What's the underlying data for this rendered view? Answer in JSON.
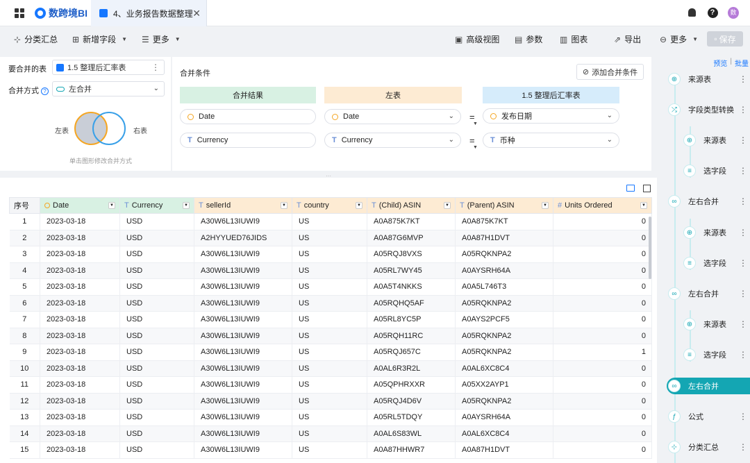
{
  "app": {
    "logo_text": "数跨境BI",
    "tab_title": "4、业务报告数据整理",
    "avatar_text": "数"
  },
  "toolbar": {
    "group_summary": "分类汇总",
    "add_field": "新增字段",
    "more_left": "更多",
    "advanced_view": "高级视图",
    "params": "参数",
    "chart": "图表",
    "export": "导出",
    "more_right": "更多",
    "save": "保存"
  },
  "config": {
    "merge_table_label": "要合并的表",
    "merge_table_value": "1.5 整理后汇率表",
    "merge_method_label": "合并方式",
    "merge_method_value": "左合并",
    "venn_left": "左表",
    "venn_right": "右表",
    "venn_hint": "单击图形修改合并方式"
  },
  "conditions": {
    "title": "合并条件",
    "add_button": "添加合并条件",
    "col_result": "合并结果",
    "col_left": "左表",
    "col_right": "1.5 整理后汇率表",
    "rows": [
      {
        "result": "Date",
        "left": "Date",
        "op": "=",
        "right": "发布日期",
        "type": "date"
      },
      {
        "result": "Currency",
        "left": "Currency",
        "op": "=",
        "right": "币种",
        "type": "text"
      }
    ],
    "colors": {
      "result": "#d8f1e3",
      "left": "#fdebd3",
      "right": "#d6ecfb"
    }
  },
  "table": {
    "columns": [
      "序号",
      "Date",
      "Currency",
      "sellerId",
      "country",
      "(Child) ASIN",
      "(Parent) ASIN",
      "Units Ordered"
    ],
    "rows": [
      [
        "1",
        "2023-03-18",
        "USD",
        "A30W6L13IUWI9",
        "US",
        "A0A875K7KT",
        "A0A875K7KT",
        "0"
      ],
      [
        "2",
        "2023-03-18",
        "USD",
        "A2HYYUED76JIDS",
        "US",
        "A0A87G6MVP",
        "A0A87H1DVT",
        "0"
      ],
      [
        "3",
        "2023-03-18",
        "USD",
        "A30W6L13IUWI9",
        "US",
        "A05RQJ8VXS",
        "A05RQKNPA2",
        "0"
      ],
      [
        "4",
        "2023-03-18",
        "USD",
        "A30W6L13IUWI9",
        "US",
        "A05RL7WY45",
        "A0AYSRH64A",
        "0"
      ],
      [
        "5",
        "2023-03-18",
        "USD",
        "A30W6L13IUWI9",
        "US",
        "A0A5T4NKKS",
        "A0A5L746T3",
        "0"
      ],
      [
        "6",
        "2023-03-18",
        "USD",
        "A30W6L13IUWI9",
        "US",
        "A05RQHQ5AF",
        "A05RQKNPA2",
        "0"
      ],
      [
        "7",
        "2023-03-18",
        "USD",
        "A30W6L13IUWI9",
        "US",
        "A05RL8YC5P",
        "A0AYS2PCF5",
        "0"
      ],
      [
        "8",
        "2023-03-18",
        "USD",
        "A30W6L13IUWI9",
        "US",
        "A05RQH11RC",
        "A05RQKNPA2",
        "0"
      ],
      [
        "9",
        "2023-03-18",
        "USD",
        "A30W6L13IUWI9",
        "US",
        "A05RQJ657C",
        "A05RQKNPA2",
        "1"
      ],
      [
        "10",
        "2023-03-18",
        "USD",
        "A30W6L13IUWI9",
        "US",
        "A0AL6R3R2L",
        "A0AL6XC8C4",
        "0"
      ],
      [
        "11",
        "2023-03-18",
        "USD",
        "A30W6L13IUWI9",
        "US",
        "A05QPHRXXR",
        "A05XX2AYP1",
        "0"
      ],
      [
        "12",
        "2023-03-18",
        "USD",
        "A30W6L13IUWI9",
        "US",
        "A05RQJ4D6V",
        "A05RQKNPA2",
        "0"
      ],
      [
        "13",
        "2023-03-18",
        "USD",
        "A30W6L13IUWI9",
        "US",
        "A05RL5TDQY",
        "A0AYSRH64A",
        "0"
      ],
      [
        "14",
        "2023-03-18",
        "USD",
        "A30W6L13IUWI9",
        "US",
        "A0AL6S83WL",
        "A0AL6XC8C4",
        "0"
      ],
      [
        "15",
        "2023-03-18",
        "USD",
        "A30W6L13IUWI9",
        "US",
        "A0A87HHWR7",
        "A0A87H1DVT",
        "0"
      ]
    ]
  },
  "flow": {
    "preview": "预览",
    "batch": "批量",
    "nodes": [
      {
        "label": "来源表",
        "icon": "source-icon",
        "level": 0
      },
      {
        "label": "字段类型转换",
        "icon": "convert-icon",
        "level": 0
      },
      {
        "label": "来源表",
        "icon": "source-icon",
        "level": 1
      },
      {
        "label": "选字段",
        "icon": "select-field-icon",
        "level": 1
      },
      {
        "label": "左右合并",
        "icon": "merge-icon",
        "level": 0
      },
      {
        "label": "来源表",
        "icon": "source-icon",
        "level": 1
      },
      {
        "label": "选字段",
        "icon": "select-field-icon",
        "level": 1
      },
      {
        "label": "左右合并",
        "icon": "merge-icon",
        "level": 0
      },
      {
        "label": "来源表",
        "icon": "source-icon",
        "level": 1
      },
      {
        "label": "选字段",
        "icon": "select-field-icon",
        "level": 1
      },
      {
        "label": "左右合并",
        "icon": "merge-icon",
        "level": 0,
        "active": true
      },
      {
        "label": "公式",
        "icon": "formula-icon",
        "level": 0
      },
      {
        "label": "分类汇总",
        "icon": "group-icon",
        "level": 0
      }
    ],
    "accent": "#14a6b3"
  }
}
